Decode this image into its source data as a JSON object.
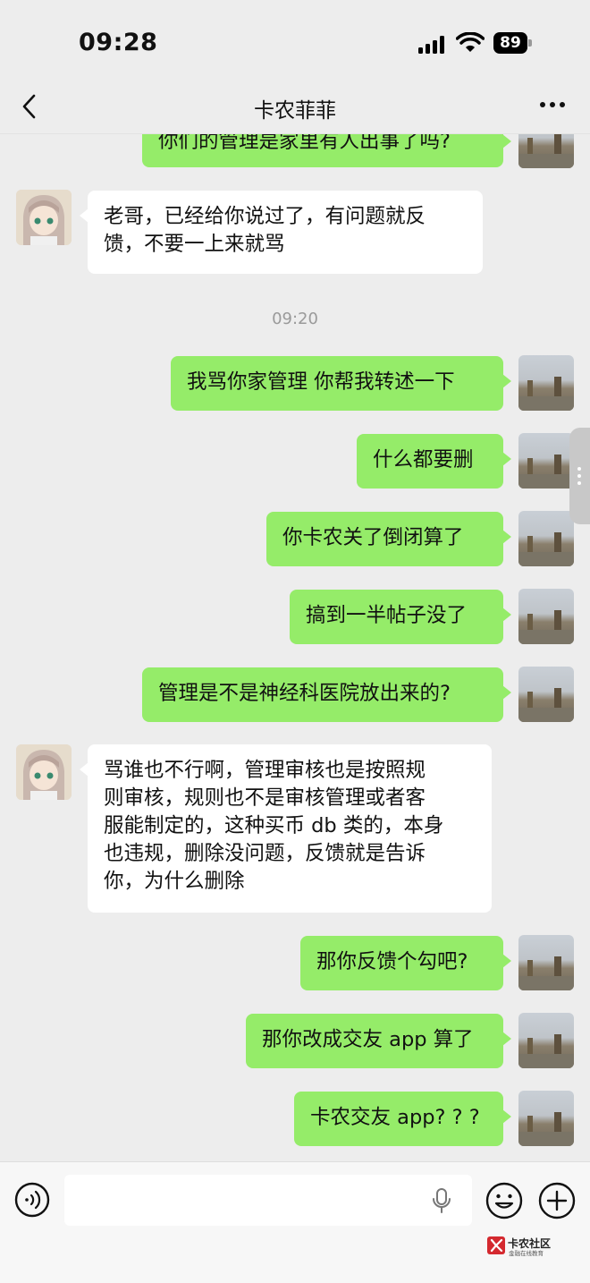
{
  "status_bar": {
    "time": "09:28",
    "battery": "89"
  },
  "nav": {
    "title": "卡农菲菲"
  },
  "chat": {
    "messages": [
      {
        "text": "你们的管理是家里有人出事了吗?"
      },
      {
        "lines": [
          "老哥，已经给你说过了，有问题就反",
          "馈，不要一上来就骂"
        ]
      },
      {
        "text": "09:20"
      },
      {
        "text": "我骂你家管理 你帮我转述一下"
      },
      {
        "text": "什么都要删"
      },
      {
        "text": "你卡农关了倒闭算了"
      },
      {
        "text": "搞到一半帖子没了"
      },
      {
        "text": "管理是不是神经科医院放出来的?"
      },
      {
        "lines": [
          "骂谁也不行啊，管理审核也是按照规",
          "则审核，规则也不是审核管理或者客",
          "服能制定的，这种买币 db 类的，本身",
          "也违规，删除没问题，反馈就是告诉",
          "你，为什么删除"
        ]
      },
      {
        "text": "那你反馈个勾吧?"
      },
      {
        "text": "那你改成交友 app 算了"
      },
      {
        "text": "卡农交友 app? ? ?"
      }
    ]
  },
  "input_bar": {
    "placeholder": ""
  },
  "watermark": {
    "name": "卡农社区",
    "sub": "金融在线教育"
  },
  "colors": {
    "outgoing_bubble": "#95ec69",
    "incoming_bubble": "#ffffff",
    "background": "#ededed"
  },
  "icons": [
    "back-arrow-icon",
    "more-icon",
    "signal-icon",
    "wifi-icon",
    "battery-icon",
    "voice-icon",
    "mic-icon",
    "emoji-icon",
    "plus-icon"
  ]
}
